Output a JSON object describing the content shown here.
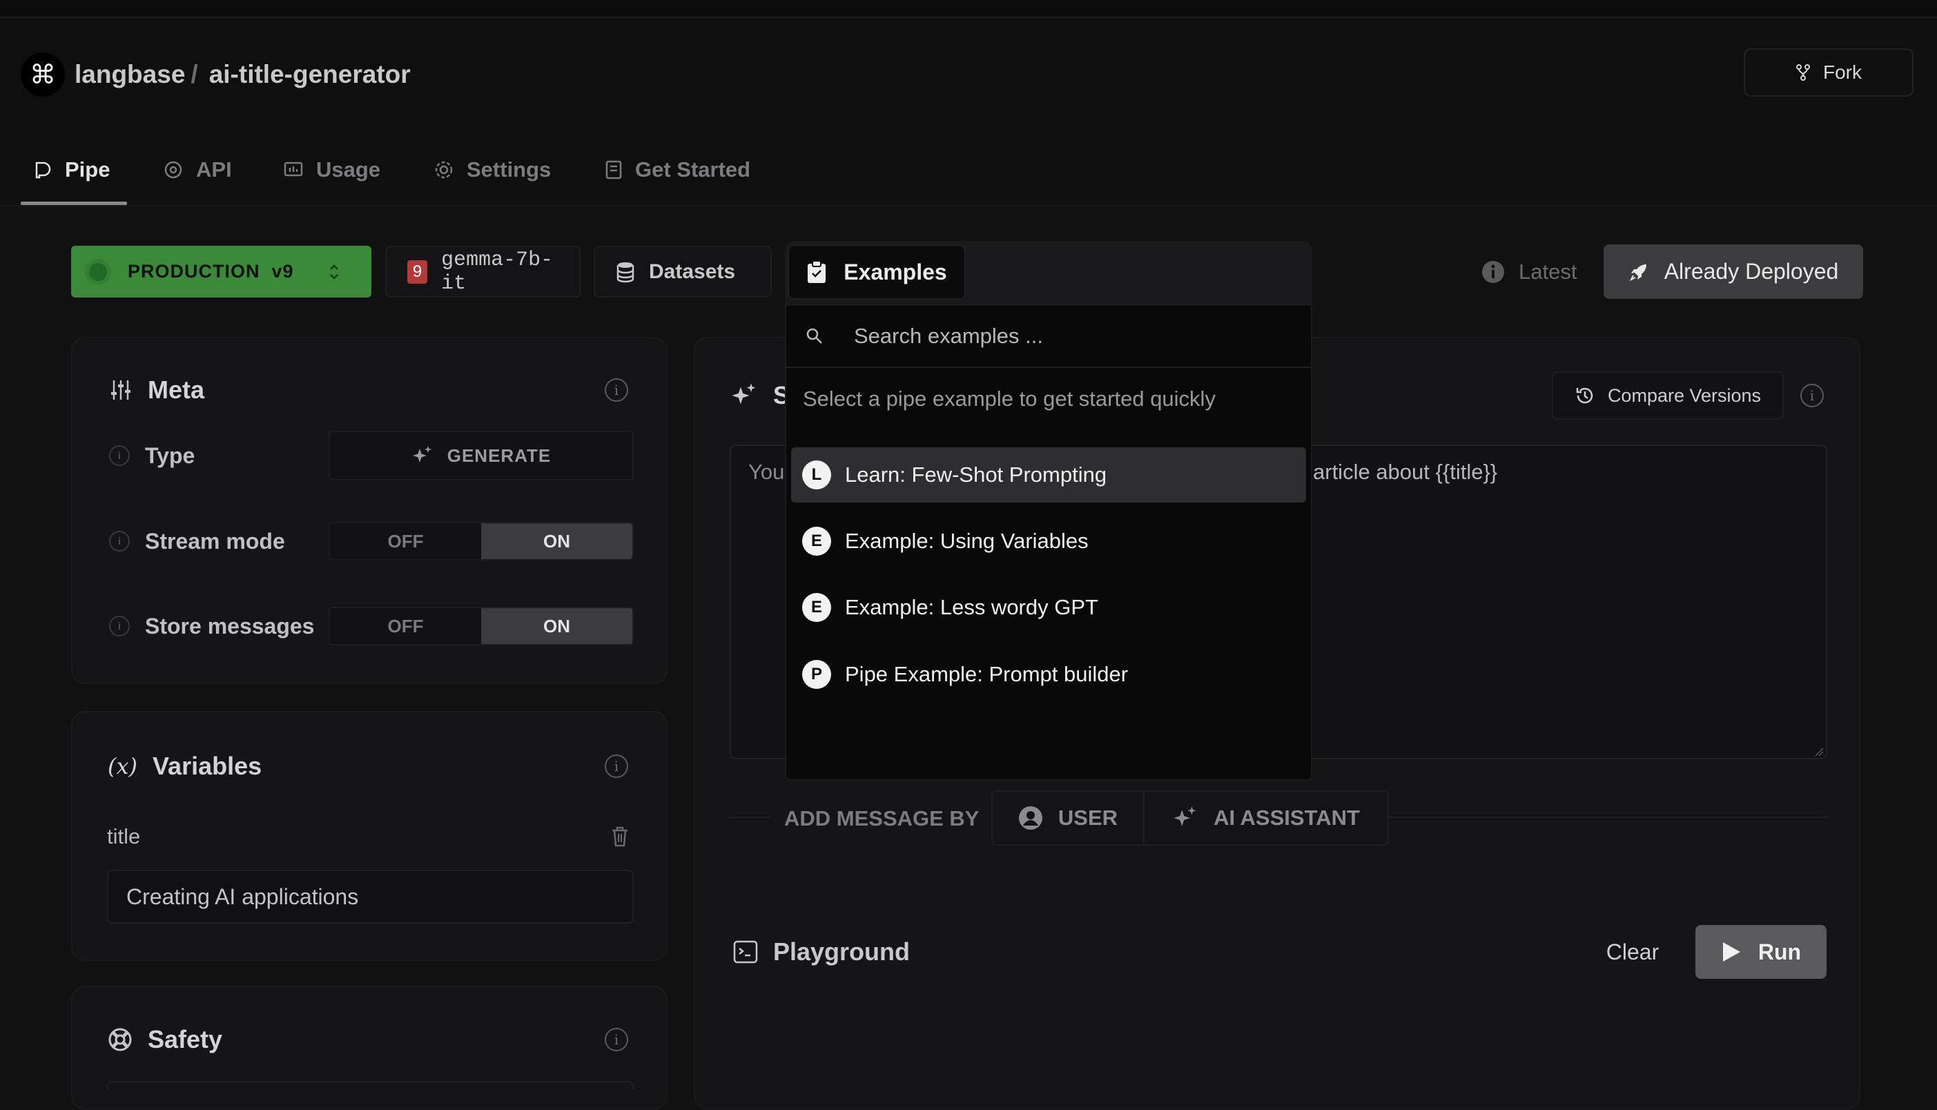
{
  "header": {
    "logo_glyph": "⌘",
    "org": "langbase",
    "separator": "/",
    "pipe_name": "ai-title-generator",
    "fork_label": "Fork"
  },
  "tabs": [
    {
      "label": "Pipe",
      "icon": "pipe-icon",
      "active": true
    },
    {
      "label": "API",
      "icon": "api-icon"
    },
    {
      "label": "Usage",
      "icon": "usage-icon"
    },
    {
      "label": "Settings",
      "icon": "gear-icon"
    },
    {
      "label": "Get Started",
      "icon": "doc-icon"
    }
  ],
  "toolbar": {
    "environment": "PRODUCTION",
    "version": "v9",
    "model_badge": "9",
    "model": "gemma-7b-it",
    "datasets_label": "Datasets",
    "latest_label": "Latest",
    "deploy_label": "Already Deployed"
  },
  "meta": {
    "title": "Meta",
    "type_label": "Type",
    "type_value": "GENERATE",
    "stream_label": "Stream mode",
    "store_label": "Store messages",
    "off": "OFF",
    "on": "ON"
  },
  "variables": {
    "title": "Variables",
    "icon_glyph": "(x)",
    "var_name": "title",
    "var_value": "Creating AI applications"
  },
  "safety": {
    "title": "Safety"
  },
  "prompt": {
    "title_partial": "S",
    "compare_label": "Compare Versions",
    "text_left": "You",
    "text_right": "article about {{title}}"
  },
  "add_message": {
    "label": "ADD MESSAGE BY",
    "user": "USER",
    "assistant": "AI ASSISTANT"
  },
  "playground": {
    "title": "Playground",
    "clear": "Clear",
    "run": "Run"
  },
  "examples_dropdown": {
    "tab_label": "Examples",
    "search_placeholder": "Search examples ...",
    "hint": "Select a pipe example to get started quickly",
    "items": [
      {
        "badge": "L",
        "label": "Learn: Few-Shot Prompting",
        "selected": true
      },
      {
        "badge": "E",
        "label": "Example: Using Variables"
      },
      {
        "badge": "E",
        "label": "Example: Less wordy GPT"
      },
      {
        "badge": "P",
        "label": "Pipe Example: Prompt builder"
      }
    ]
  },
  "colors": {
    "background": "#111112",
    "production": "#3a8a3a",
    "deploy_button": "#3c3c3e",
    "model_badge": "#b43a3a"
  }
}
